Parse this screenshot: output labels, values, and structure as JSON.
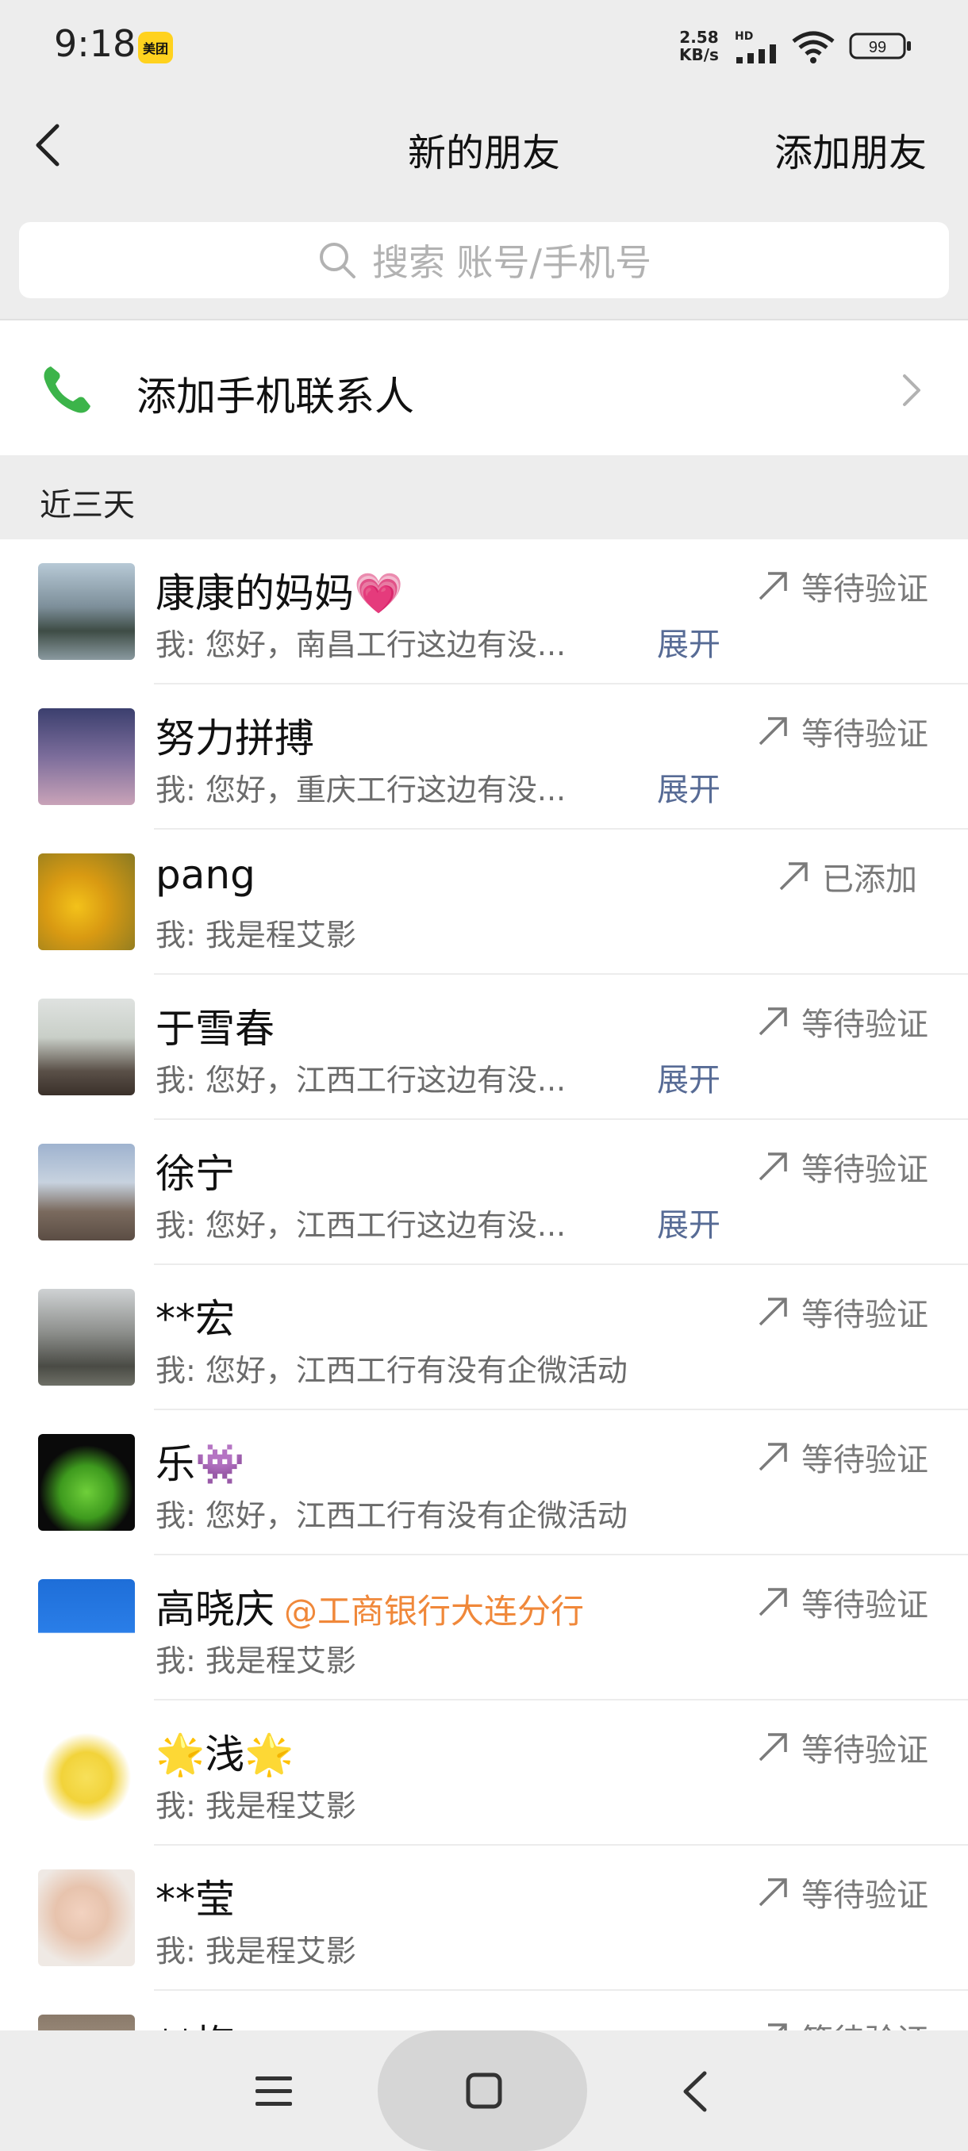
{
  "status_bar": {
    "time": "9:18",
    "app_badge": "美团",
    "net_speed_value": "2.58",
    "net_speed_unit": "KB/s",
    "hd": "HD",
    "battery": "99"
  },
  "nav": {
    "title": "新的朋友",
    "add_friend": "添加朋友"
  },
  "search": {
    "placeholder": "搜索 账号/手机号"
  },
  "phone_contacts": {
    "label": "添加手机联系人"
  },
  "section": {
    "label": "近三天"
  },
  "friends": [
    {
      "name": "康康的妈妈💗",
      "org": "",
      "msg": "我: 您好，南昌工行这边有没...",
      "expand": "展开",
      "status": "等待验证"
    },
    {
      "name": "努力拼搏",
      "org": "",
      "msg": "我: 您好，重庆工行这边有没...",
      "expand": "展开",
      "status": "等待验证"
    },
    {
      "name": "pang",
      "org": "",
      "msg": "我: 我是程艾影",
      "expand": "",
      "status": "已添加"
    },
    {
      "name": "于雪春",
      "org": "",
      "msg": "我: 您好，江西工行这边有没...",
      "expand": "展开",
      "status": "等待验证"
    },
    {
      "name": "徐宁",
      "org": "",
      "msg": "我: 您好，江西工行这边有没...",
      "expand": "展开",
      "status": "等待验证"
    },
    {
      "name": "**宏",
      "org": "",
      "msg": "我: 您好，江西工行有没有企微活动",
      "expand": "",
      "status": "等待验证"
    },
    {
      "name": "乐👾",
      "org": "",
      "msg": "我: 您好，江西工行有没有企微活动",
      "expand": "",
      "status": "等待验证"
    },
    {
      "name": "高晓庆",
      "org": "@工商银行大连分行",
      "msg": "我: 我是程艾影",
      "expand": "",
      "status": "等待验证"
    },
    {
      "name": "🌟浅🌟",
      "org": "",
      "msg": "我: 我是程艾影",
      "expand": "",
      "status": "等待验证"
    },
    {
      "name": "**莹",
      "org": "",
      "msg": "我: 我是程艾影",
      "expand": "",
      "status": "等待验证"
    },
    {
      "name": "**梅",
      "org": "",
      "msg": "",
      "expand": "",
      "status": "等待验证"
    }
  ],
  "colors": {
    "background": "#ededed",
    "link_blue": "#576b95",
    "org_orange": "#f0883a",
    "phone_green": "#3cb44a"
  }
}
